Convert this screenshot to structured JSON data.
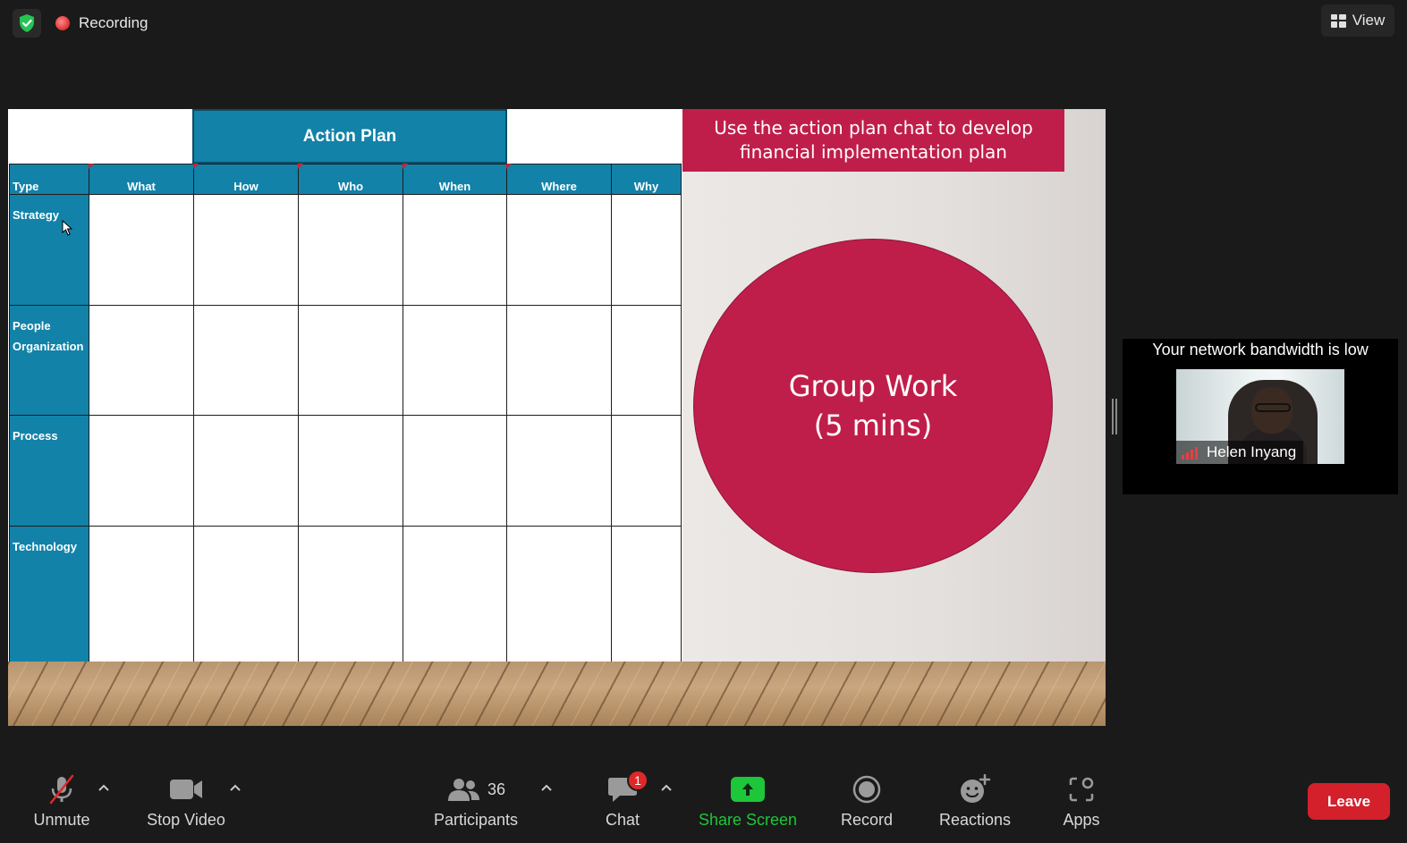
{
  "topbar": {
    "security_icon": "shield-check-icon",
    "recording_label": "Recording",
    "view_label": "View"
  },
  "slide": {
    "action_plan_title": "Action Plan",
    "columns": [
      "Type",
      "What",
      "How",
      "Who",
      "When",
      "Where",
      "Why"
    ],
    "rows": [
      {
        "label_1": "Strategy",
        "label_2": ""
      },
      {
        "label_1": "People",
        "label_2": "Organization"
      },
      {
        "label_1": "Process",
        "label_2": ""
      },
      {
        "label_1": "Technology",
        "label_2": ""
      }
    ],
    "banner_line1": "Use the action plan chat to develop",
    "banner_line2": "financial implementation plan",
    "circle_line1": "Group Work",
    "circle_line2": "(5 mins)",
    "colors": {
      "teal": "#1282a8",
      "crimson": "#c01e4a"
    }
  },
  "participant": {
    "network_warning": "Your network bandwidth is low",
    "name": "Helen Inyang"
  },
  "toolbar": {
    "unmute_label": "Unmute",
    "stop_video_label": "Stop Video",
    "participants_label": "Participants",
    "participants_count": "36",
    "chat_label": "Chat",
    "chat_badge": "1",
    "share_screen_label": "Share Screen",
    "record_label": "Record",
    "reactions_label": "Reactions",
    "apps_label": "Apps",
    "leave_label": "Leave",
    "share_color": "#1ec63a",
    "leave_color": "#d4202a"
  }
}
